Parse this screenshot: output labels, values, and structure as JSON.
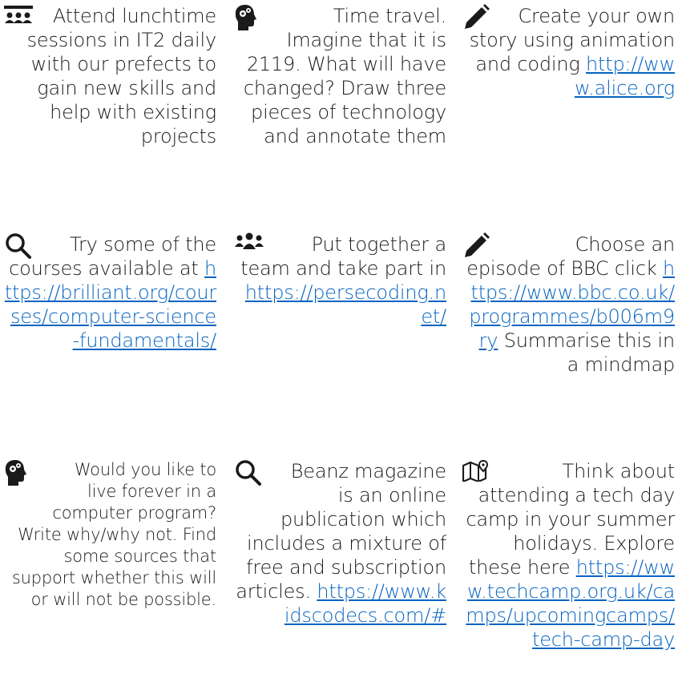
{
  "colors": {
    "text": "#1a1a1a",
    "link": "#0563c1"
  },
  "grid": [
    {
      "icon": "audience-icon",
      "text": "Attend lunchtime sessions in IT2 daily with our prefects to gain new skills and help with existing projects",
      "link": "",
      "text_after": ""
    },
    {
      "icon": "brain-gears-icon",
      "text": "Time travel. Imagine that it is 2119. What will have changed? Draw three pieces of technology and annotate them",
      "link": "",
      "text_after": ""
    },
    {
      "icon": "pencil-icon",
      "text": "Create your own story using animation and coding",
      "link": "http://www.alice.org",
      "text_after": ""
    },
    {
      "icon": "search-icon",
      "text": "Try some of the courses available at",
      "link": "https://brilliant.org/courses/computer-science-fundamentals/",
      "text_after": ""
    },
    {
      "icon": "team-icon",
      "text": "Put together a team and take part in",
      "link": "https://persecoding.net/",
      "text_after": ""
    },
    {
      "icon": "pencil-icon",
      "text": "Choose an episode of BBC click",
      "link": "https://www.bbc.co.uk/programmes/b006m9ry",
      "text_after": "Summarise this in a mindmap"
    },
    {
      "icon": "brain-gears-icon",
      "text": "Would you like to live forever in a computer program? Write why/why not. Find some sources that support whether this will or will not be possible.",
      "link": "",
      "text_after": ""
    },
    {
      "icon": "search-icon",
      "text": "Beanz magazine is an online publication which includes a mixture of free and subscription articles.",
      "link": "https://www.kidscodecs.com/#",
      "text_after": ""
    },
    {
      "icon": "map-pin-icon",
      "text": "Think about attending a tech day camp in your summer holidays. Explore these here",
      "link": "https://www.techcamp.org.uk/camps/upcomingcamps/tech-camp-day",
      "text_after": ""
    }
  ]
}
